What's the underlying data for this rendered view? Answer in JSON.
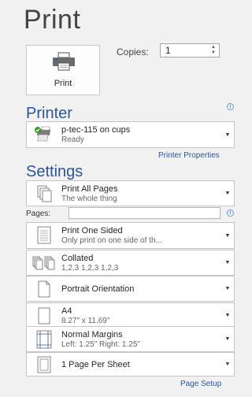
{
  "header": {
    "title": "Print"
  },
  "print_button": {
    "label": "Print"
  },
  "copies": {
    "label": "Copies:",
    "value": "1"
  },
  "printer": {
    "section_title": "Printer",
    "name": "p-tec-115 on cups",
    "status": "Ready",
    "properties_link": "Printer Properties"
  },
  "settings": {
    "section_title": "Settings",
    "pages_label": "Pages:",
    "pages_value": "",
    "items": [
      {
        "main": "Print All Pages",
        "sub": "The whole thing",
        "icon": "pages-icon"
      },
      {
        "main": "Print One Sided",
        "sub": "Only print on one side of th...",
        "icon": "one-sided-icon"
      },
      {
        "main": "Collated",
        "sub": "1,2,3   1,2,3   1,2,3",
        "icon": "collated-icon"
      },
      {
        "main": "Portrait Orientation",
        "sub": "",
        "icon": "portrait-icon"
      },
      {
        "main": "A4",
        "sub": "8.27\" x 11.69\"",
        "icon": "paper-size-icon"
      },
      {
        "main": "Normal Margins",
        "sub": "Left:  1.25\"    Right:  1.25\"",
        "icon": "margins-icon"
      },
      {
        "main": "1 Page Per Sheet",
        "sub": "",
        "icon": "pages-per-sheet-icon"
      }
    ],
    "page_setup_link": "Page Setup"
  },
  "colors": {
    "accent": "#2b579a",
    "background": "#f1f1f1"
  }
}
